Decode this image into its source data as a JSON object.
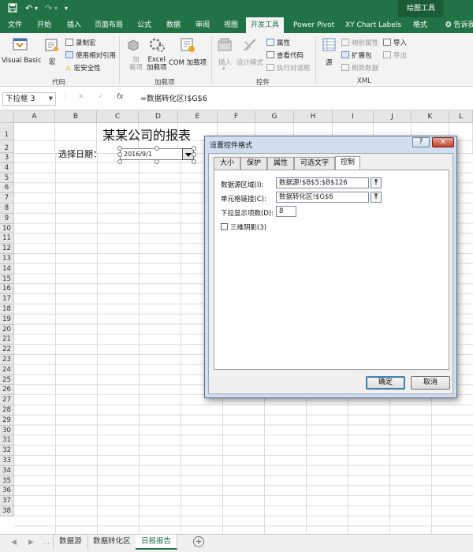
{
  "quick_access": {
    "save_icon": "save-icon",
    "undo_icon": "undo-icon",
    "redo_icon": "redo-icon",
    "customize_icon": "customize-icon"
  },
  "context_tools": "绘图工具",
  "tabs": [
    "文件",
    "开始",
    "插入",
    "页面布局",
    "公式",
    "数据",
    "审阅",
    "视图",
    "开发工具",
    "Power Pivot",
    "XY Chart Labels",
    "格式"
  ],
  "active_tab": "开发工具",
  "tell_me": "告诉我",
  "ribbon": {
    "code": {
      "label": "代码",
      "visual_basic": "Visual Basic",
      "macro": "宏",
      "record": "录制宏",
      "relative": "使用相对引用",
      "security": "宏安全性"
    },
    "addins": {
      "label": "加载项",
      "addins": "加\n载项",
      "excel_addins": "Excel\n加载项",
      "com_addins": "COM 加载项"
    },
    "controls": {
      "label": "控件",
      "insert": "插入",
      "design_mode": "设计模式",
      "properties": "属性",
      "view_code": "查看代码",
      "run_dialog": "执行对话框"
    },
    "source": {
      "source": "源"
    },
    "xml": {
      "label": "XML",
      "map_props": "映射属性",
      "expansion": "扩展包",
      "refresh": "刷新数据",
      "import": "导入",
      "export": "导出"
    }
  },
  "namebox": "下拉框 3",
  "formula": "=数据转化区!$G$6",
  "columns": [
    "A",
    "B",
    "C",
    "D",
    "E",
    "F",
    "G",
    "H",
    "I",
    "J",
    "K",
    "L"
  ],
  "rows": [
    "1",
    "2",
    "3",
    "4",
    "5",
    "6",
    "7",
    "8",
    "9",
    "10",
    "11",
    "12",
    "13",
    "14",
    "15",
    "16",
    "17",
    "18",
    "19",
    "20",
    "21",
    "22",
    "23",
    "24",
    "25",
    "26",
    "27",
    "28",
    "29",
    "30",
    "31",
    "32",
    "33",
    "34",
    "35",
    "36",
    "37",
    "38"
  ],
  "sheet": {
    "title": "某某公司的报表",
    "date_label": "选择日期：",
    "combo_value": "2016/9/1"
  },
  "sheet_tabs": [
    "数据源",
    "数据转化区",
    "日报报告"
  ],
  "active_sheet": "日报报告",
  "dialog": {
    "title": "设置控件格式",
    "help": "?",
    "close": "✕",
    "tabs": [
      "大小",
      "保护",
      "属性",
      "可选文字",
      "控制"
    ],
    "active_tab": "控制",
    "fields": {
      "source_label": "数据源区域(I):",
      "source_value": "数据源!$B$5:$B$126",
      "link_label": "单元格链接(C):",
      "link_value": "数据转化区!$G$6",
      "lines_label": "下拉显示项数(D):",
      "lines_value": "8"
    },
    "shading_label": "三维阴影(3)",
    "shading_checked": false,
    "ok": "确定",
    "cancel": "取消"
  }
}
